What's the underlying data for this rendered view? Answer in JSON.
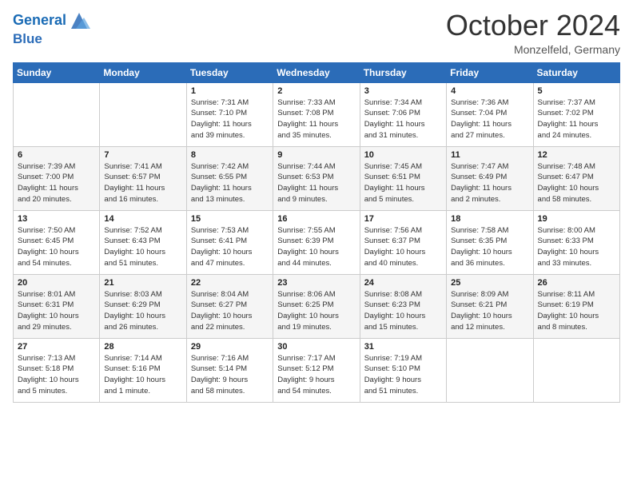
{
  "header": {
    "logo_line1": "General",
    "logo_line2": "Blue",
    "month": "October 2024",
    "location": "Monzelfeld, Germany"
  },
  "weekdays": [
    "Sunday",
    "Monday",
    "Tuesday",
    "Wednesday",
    "Thursday",
    "Friday",
    "Saturday"
  ],
  "weeks": [
    [
      {
        "day": "",
        "info": ""
      },
      {
        "day": "",
        "info": ""
      },
      {
        "day": "1",
        "info": "Sunrise: 7:31 AM\nSunset: 7:10 PM\nDaylight: 11 hours\nand 39 minutes."
      },
      {
        "day": "2",
        "info": "Sunrise: 7:33 AM\nSunset: 7:08 PM\nDaylight: 11 hours\nand 35 minutes."
      },
      {
        "day": "3",
        "info": "Sunrise: 7:34 AM\nSunset: 7:06 PM\nDaylight: 11 hours\nand 31 minutes."
      },
      {
        "day": "4",
        "info": "Sunrise: 7:36 AM\nSunset: 7:04 PM\nDaylight: 11 hours\nand 27 minutes."
      },
      {
        "day": "5",
        "info": "Sunrise: 7:37 AM\nSunset: 7:02 PM\nDaylight: 11 hours\nand 24 minutes."
      }
    ],
    [
      {
        "day": "6",
        "info": "Sunrise: 7:39 AM\nSunset: 7:00 PM\nDaylight: 11 hours\nand 20 minutes."
      },
      {
        "day": "7",
        "info": "Sunrise: 7:41 AM\nSunset: 6:57 PM\nDaylight: 11 hours\nand 16 minutes."
      },
      {
        "day": "8",
        "info": "Sunrise: 7:42 AM\nSunset: 6:55 PM\nDaylight: 11 hours\nand 13 minutes."
      },
      {
        "day": "9",
        "info": "Sunrise: 7:44 AM\nSunset: 6:53 PM\nDaylight: 11 hours\nand 9 minutes."
      },
      {
        "day": "10",
        "info": "Sunrise: 7:45 AM\nSunset: 6:51 PM\nDaylight: 11 hours\nand 5 minutes."
      },
      {
        "day": "11",
        "info": "Sunrise: 7:47 AM\nSunset: 6:49 PM\nDaylight: 11 hours\nand 2 minutes."
      },
      {
        "day": "12",
        "info": "Sunrise: 7:48 AM\nSunset: 6:47 PM\nDaylight: 10 hours\nand 58 minutes."
      }
    ],
    [
      {
        "day": "13",
        "info": "Sunrise: 7:50 AM\nSunset: 6:45 PM\nDaylight: 10 hours\nand 54 minutes."
      },
      {
        "day": "14",
        "info": "Sunrise: 7:52 AM\nSunset: 6:43 PM\nDaylight: 10 hours\nand 51 minutes."
      },
      {
        "day": "15",
        "info": "Sunrise: 7:53 AM\nSunset: 6:41 PM\nDaylight: 10 hours\nand 47 minutes."
      },
      {
        "day": "16",
        "info": "Sunrise: 7:55 AM\nSunset: 6:39 PM\nDaylight: 10 hours\nand 44 minutes."
      },
      {
        "day": "17",
        "info": "Sunrise: 7:56 AM\nSunset: 6:37 PM\nDaylight: 10 hours\nand 40 minutes."
      },
      {
        "day": "18",
        "info": "Sunrise: 7:58 AM\nSunset: 6:35 PM\nDaylight: 10 hours\nand 36 minutes."
      },
      {
        "day": "19",
        "info": "Sunrise: 8:00 AM\nSunset: 6:33 PM\nDaylight: 10 hours\nand 33 minutes."
      }
    ],
    [
      {
        "day": "20",
        "info": "Sunrise: 8:01 AM\nSunset: 6:31 PM\nDaylight: 10 hours\nand 29 minutes."
      },
      {
        "day": "21",
        "info": "Sunrise: 8:03 AM\nSunset: 6:29 PM\nDaylight: 10 hours\nand 26 minutes."
      },
      {
        "day": "22",
        "info": "Sunrise: 8:04 AM\nSunset: 6:27 PM\nDaylight: 10 hours\nand 22 minutes."
      },
      {
        "day": "23",
        "info": "Sunrise: 8:06 AM\nSunset: 6:25 PM\nDaylight: 10 hours\nand 19 minutes."
      },
      {
        "day": "24",
        "info": "Sunrise: 8:08 AM\nSunset: 6:23 PM\nDaylight: 10 hours\nand 15 minutes."
      },
      {
        "day": "25",
        "info": "Sunrise: 8:09 AM\nSunset: 6:21 PM\nDaylight: 10 hours\nand 12 minutes."
      },
      {
        "day": "26",
        "info": "Sunrise: 8:11 AM\nSunset: 6:19 PM\nDaylight: 10 hours\nand 8 minutes."
      }
    ],
    [
      {
        "day": "27",
        "info": "Sunrise: 7:13 AM\nSunset: 5:18 PM\nDaylight: 10 hours\nand 5 minutes."
      },
      {
        "day": "28",
        "info": "Sunrise: 7:14 AM\nSunset: 5:16 PM\nDaylight: 10 hours\nand 1 minute."
      },
      {
        "day": "29",
        "info": "Sunrise: 7:16 AM\nSunset: 5:14 PM\nDaylight: 9 hours\nand 58 minutes."
      },
      {
        "day": "30",
        "info": "Sunrise: 7:17 AM\nSunset: 5:12 PM\nDaylight: 9 hours\nand 54 minutes."
      },
      {
        "day": "31",
        "info": "Sunrise: 7:19 AM\nSunset: 5:10 PM\nDaylight: 9 hours\nand 51 minutes."
      },
      {
        "day": "",
        "info": ""
      },
      {
        "day": "",
        "info": ""
      }
    ]
  ]
}
